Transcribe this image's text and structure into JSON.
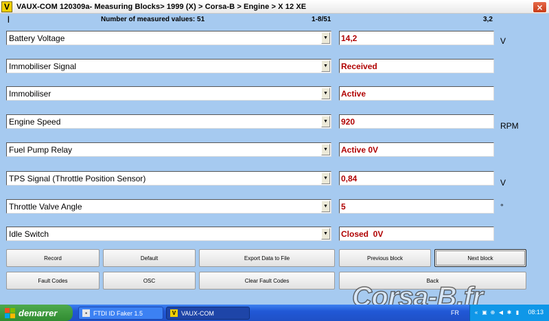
{
  "window": {
    "icon_letter": "V",
    "title": "VAUX-COM 120309a- Measuring Blocks> 1999 (X) > Corsa-B > Engine > X 12 XE",
    "close_label": "×"
  },
  "status": {
    "marker": "|",
    "count_text": "Number of measured values: 51",
    "pager_text": "1-8/51",
    "cycle_text": "3,2"
  },
  "rows": [
    {
      "label": "Battery Voltage",
      "value": "14,2",
      "unit": "V"
    },
    {
      "label": "Immobiliser Signal",
      "value": "Received",
      "unit": ""
    },
    {
      "label": "Immobiliser",
      "value": "Active",
      "unit": ""
    },
    {
      "label": "Engine Speed",
      "value": "920",
      "unit": "RPM"
    },
    {
      "label": "Fuel Pump Relay",
      "value": "Active 0V",
      "unit": ""
    },
    {
      "label": "TPS Signal (Throttle Position Sensor)",
      "value": "0,84",
      "unit": "V"
    },
    {
      "label": "Throttle Valve Angle",
      "value": "5",
      "unit": "°"
    },
    {
      "label": "Idle Switch",
      "value": "Closed  0V",
      "unit": ""
    }
  ],
  "buttons": {
    "record": "Record",
    "default": "Default",
    "export": "Export Data to File",
    "previous_block": "Previous block",
    "next_block": "Next block",
    "fault_codes": "Fault Codes",
    "osc": "OSC",
    "clear_fault_codes": "Clear Fault Codes",
    "back": "Back"
  },
  "taskbar": {
    "start_label": "demarrer",
    "tasks": [
      {
        "label": "FTDI ID Faker 1.5",
        "icon": "usb-icon"
      },
      {
        "label": "VAUX-COM",
        "icon": "vauxcom-icon"
      }
    ],
    "lang": "FR",
    "clock": "08:13"
  },
  "watermark": "Corsa-B.fr",
  "colors": {
    "background": "#a6caf0",
    "value_text": "#b00000",
    "taskbar": "#2158d6",
    "start": "#318c31"
  }
}
